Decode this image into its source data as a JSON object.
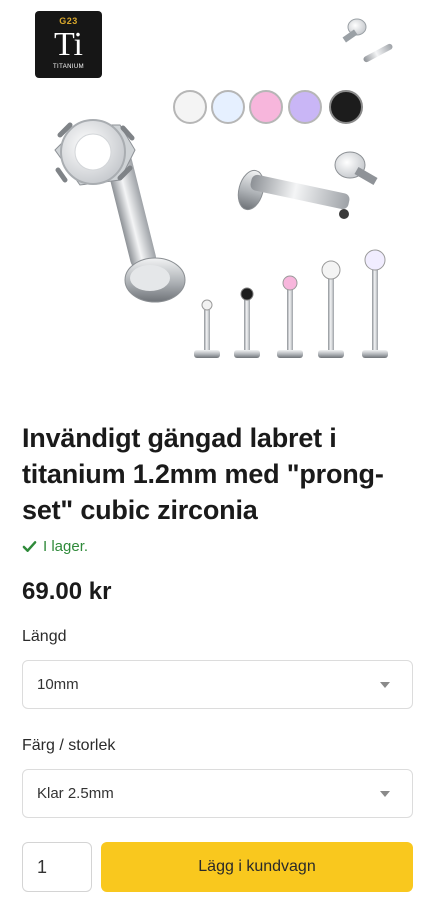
{
  "badge": {
    "grade": "G23",
    "symbol": "Ti",
    "name": "TITANIUM"
  },
  "product": {
    "title": "Invändigt gängad labret i titanium 1.2mm med \"prong-set\" cubic zirconia",
    "stock": "I lager.",
    "price": "69.00 kr"
  },
  "options": {
    "length": {
      "label": "Längd",
      "value": "10mm"
    },
    "color_size": {
      "label": "Färg / storlek",
      "value": "Klar 2.5mm"
    }
  },
  "cart": {
    "quantity": "1",
    "button_label": "Lägg i kundvagn"
  },
  "colors": {
    "stock_green": "#2f8a3a",
    "button_yellow": "#f9c81e",
    "stone_colors": [
      "#f4f4f4",
      "#e6f0ff",
      "#f7b6dc",
      "#c9b6f6",
      "#1c1c1c"
    ]
  }
}
